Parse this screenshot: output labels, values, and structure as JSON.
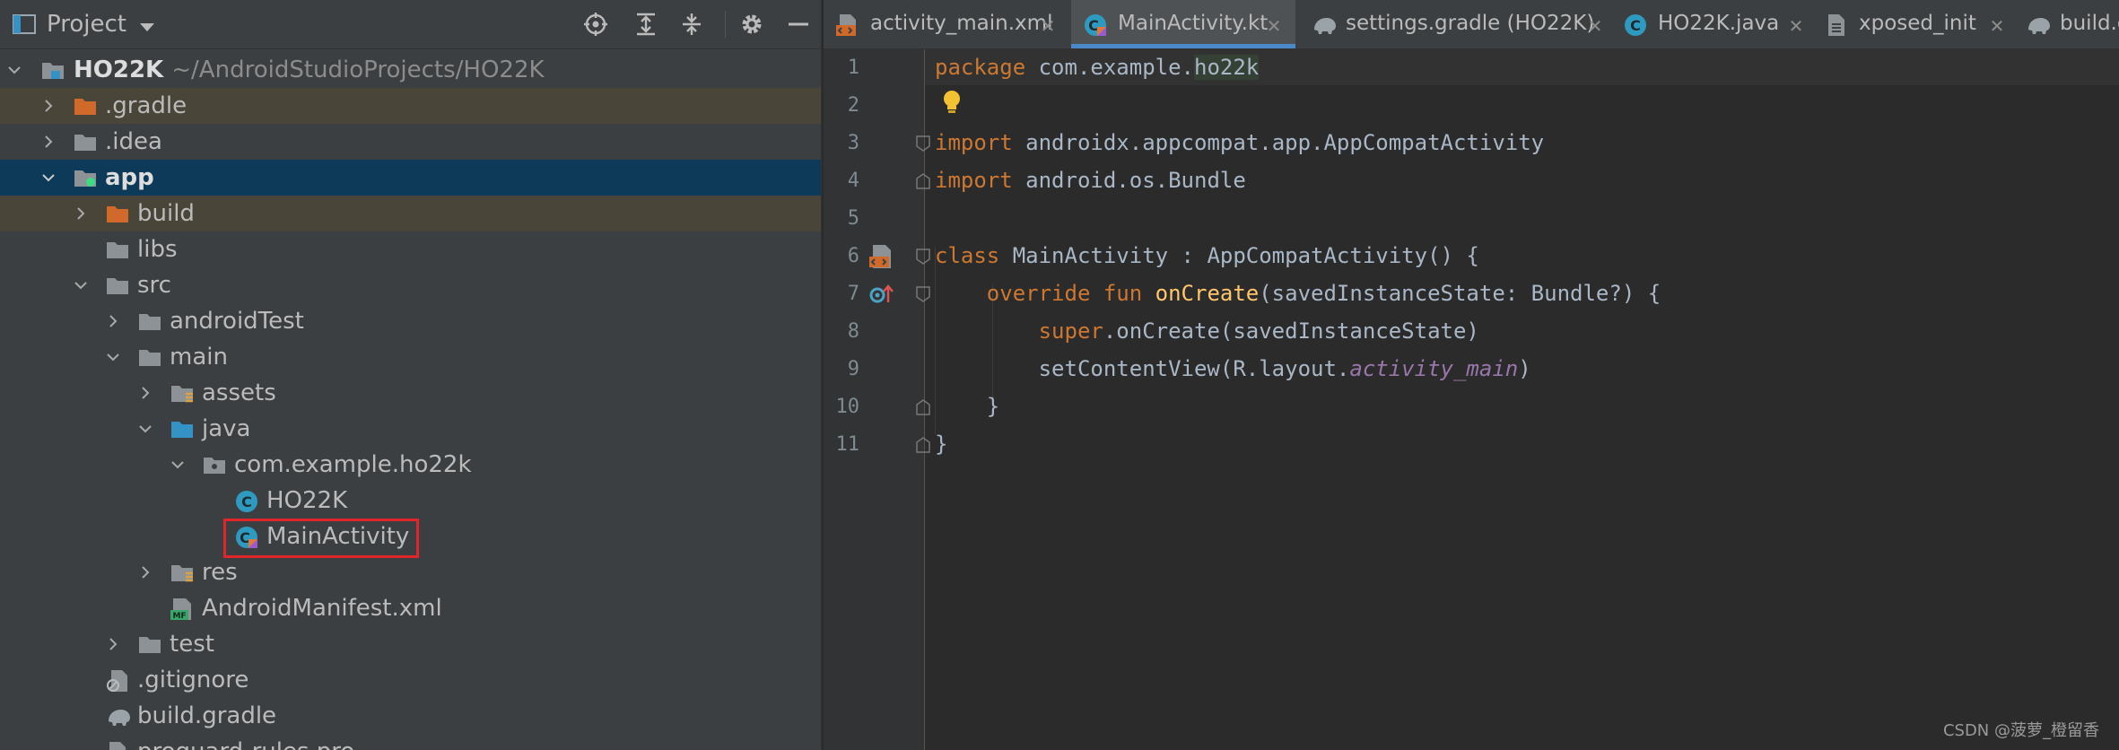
{
  "project_panel": {
    "title": "Project",
    "tree": [
      {
        "label": "HO22K",
        "path": "~/AndroidStudioProjects/HO22K"
      },
      {
        "label": ".gradle"
      },
      {
        "label": ".idea"
      },
      {
        "label": "app"
      },
      {
        "label": "build"
      },
      {
        "label": "libs"
      },
      {
        "label": "src"
      },
      {
        "label": "androidTest"
      },
      {
        "label": "main"
      },
      {
        "label": "assets"
      },
      {
        "label": "java"
      },
      {
        "label": "com.example.ho22k"
      },
      {
        "label": "HO22K"
      },
      {
        "label": "MainActivity"
      },
      {
        "label": "res"
      },
      {
        "label": "AndroidManifest.xml"
      },
      {
        "label": "test"
      },
      {
        "label": ".gitignore"
      },
      {
        "label": "build.gradle"
      },
      {
        "label": "proguard-rules.pro"
      }
    ]
  },
  "tabs": [
    {
      "label": "activity_main.xml",
      "close": "✕"
    },
    {
      "label": "MainActivity.kt",
      "close": "✕"
    },
    {
      "label": "settings.gradle (HO22K)",
      "close": "✕"
    },
    {
      "label": "HO22K.java",
      "close": "✕"
    },
    {
      "label": "xposed_init",
      "close": "✕"
    },
    {
      "label": "build.gradle"
    }
  ],
  "editor": {
    "line_numbers": [
      "1",
      "2",
      "3",
      "4",
      "5",
      "6",
      "7",
      "8",
      "9",
      "10",
      "11"
    ],
    "code": {
      "l1_kw": "package",
      "l1_pkg": " com.example.",
      "l1_hl": "ho22k",
      "l3_kw": "import",
      "l3_rest": " androidx.appcompat.app.AppCompatActivity",
      "l4_kw": "import",
      "l4_rest": " android.os.Bundle",
      "l6_kw": "class",
      "l6_rest": " MainActivity : AppCompatActivity() {",
      "l7_indent": "    ",
      "l7_kw": "override fun ",
      "l7_fn": "onCreate",
      "l7_rest": "(savedInstanceState: Bundle?) {",
      "l8_indent": "        ",
      "l8_kw": "super",
      "l8_rest": ".onCreate(savedInstanceState)",
      "l9_indent": "        ",
      "l9_pre": "setContentView(R.layout.",
      "l9_it": "activity_main",
      "l9_post": ")",
      "l10": "    }",
      "l11": "}"
    }
  },
  "watermark": "CSDN @菠萝_橙留香",
  "colors": {
    "panel_bg": "#3c3f41",
    "editor_bg": "#2b2b2b",
    "selection": "#0d3a58",
    "excluded_row": "#4a4539",
    "keyword": "#cc7832",
    "function": "#ffc66d",
    "highlight_box": "#e0262a"
  }
}
